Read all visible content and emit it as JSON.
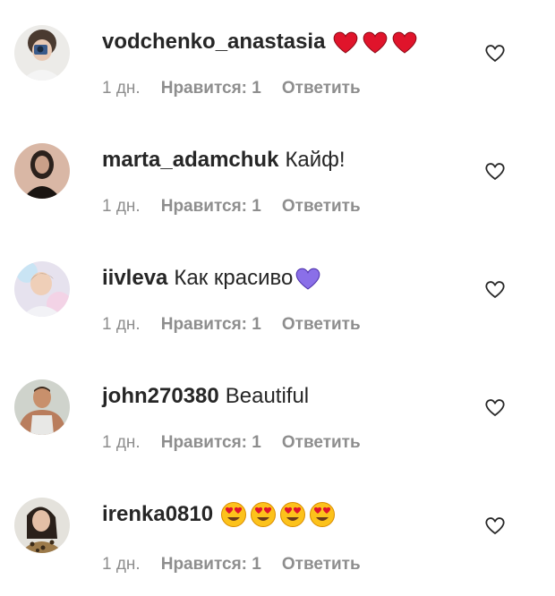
{
  "comments": [
    {
      "username": "vodchenko_anastasia",
      "text": "",
      "emojis": [
        "red-heart",
        "red-heart",
        "red-heart"
      ],
      "time": "1 дн.",
      "likes": "Нравится: 1",
      "reply": "Ответить",
      "avatar": "avatar-woman-camera"
    },
    {
      "username": "marta_adamchuk",
      "text": "Кайф!",
      "emojis": [],
      "time": "1 дн.",
      "likes": "Нравится: 1",
      "reply": "Ответить",
      "avatar": "avatar-woman-dark"
    },
    {
      "username": "iivleva",
      "text": "Как красиво",
      "emojis": [
        "purple-heart"
      ],
      "time": "1 дн.",
      "likes": "Нравится: 1",
      "reply": "Ответить",
      "avatar": "avatar-woman-pastel"
    },
    {
      "username": "john270380",
      "text": "Beautiful",
      "emojis": [],
      "time": "1 дн.",
      "likes": "Нравится: 1",
      "reply": "Ответить",
      "avatar": "avatar-man-muscular"
    },
    {
      "username": "irenka0810",
      "text": "",
      "emojis": [
        "heart-eyes-face",
        "heart-eyes-face",
        "heart-eyes-face",
        "heart-eyes-face"
      ],
      "time": "1 дн.",
      "likes": "Нравится: 1",
      "reply": "Ответить",
      "avatar": "avatar-woman-leopard"
    }
  ],
  "colors": {
    "username": "#262626",
    "meta": "#8e8e8e",
    "red_heart": "#e0142b",
    "purple_heart": "#8a6fe8",
    "like_icon": "#262626"
  },
  "icons": {
    "like_button": "heart-outline-icon"
  }
}
